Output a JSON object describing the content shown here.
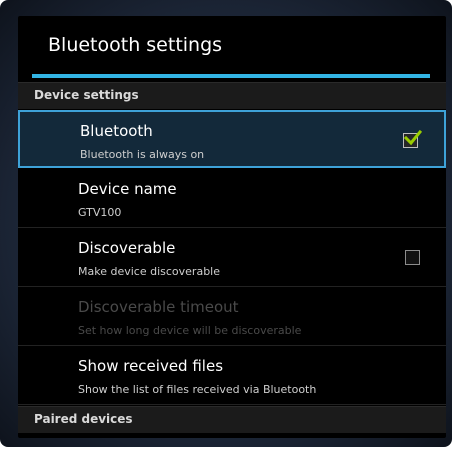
{
  "dialog": {
    "title": "Bluetooth settings"
  },
  "sections": {
    "device_settings": "Device settings",
    "paired_devices": "Paired devices"
  },
  "rows": [
    {
      "title": "Bluetooth",
      "summary": "Bluetooth is always on",
      "checked": true
    },
    {
      "title": "Device name",
      "summary": "GTV100"
    },
    {
      "title": "Discoverable",
      "summary": "Make device discoverable",
      "checked": false
    },
    {
      "title": "Discoverable timeout",
      "summary": "Set how long device will be discoverable",
      "enabled": false
    },
    {
      "title": "Show received files",
      "summary": "Show the list of files received via Bluetooth"
    }
  ],
  "colors": {
    "accent": "#33b5e5",
    "check": "#99cc00",
    "selection": "#3ea2d8"
  }
}
